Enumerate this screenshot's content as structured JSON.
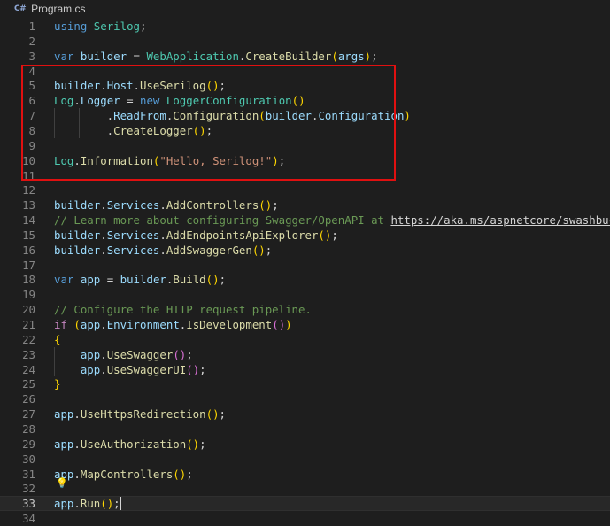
{
  "tab": {
    "icon": "csharp-icon",
    "icon_text": "C#",
    "label": "Program.cs"
  },
  "editor": {
    "current_line": 33,
    "lines": [
      {
        "n": "1",
        "tokens": [
          [
            "kw",
            "using"
          ],
          [
            "pun",
            " "
          ],
          [
            "type",
            "Serilog"
          ],
          [
            "pun",
            ";"
          ]
        ]
      },
      {
        "n": "2",
        "tokens": []
      },
      {
        "n": "3",
        "tokens": [
          [
            "kw",
            "var"
          ],
          [
            "pun",
            " "
          ],
          [
            "var",
            "builder"
          ],
          [
            "pun",
            " = "
          ],
          [
            "type",
            "WebApplication"
          ],
          [
            "pun",
            "."
          ],
          [
            "fn",
            "CreateBuilder"
          ],
          [
            "br1",
            "("
          ],
          [
            "var",
            "args"
          ],
          [
            "br1",
            ")"
          ],
          [
            "pun",
            ";"
          ]
        ]
      },
      {
        "n": "4",
        "tokens": []
      },
      {
        "n": "5",
        "tokens": [
          [
            "var",
            "builder"
          ],
          [
            "pun",
            "."
          ],
          [
            "var",
            "Host"
          ],
          [
            "pun",
            "."
          ],
          [
            "fn",
            "UseSerilog"
          ],
          [
            "br1",
            "()"
          ],
          [
            "pun",
            ";"
          ]
        ]
      },
      {
        "n": "6",
        "tokens": [
          [
            "type",
            "Log"
          ],
          [
            "pun",
            "."
          ],
          [
            "var",
            "Logger"
          ],
          [
            "pun",
            " = "
          ],
          [
            "kw",
            "new"
          ],
          [
            "pun",
            " "
          ],
          [
            "type",
            "LoggerConfiguration"
          ],
          [
            "br1",
            "()"
          ]
        ]
      },
      {
        "n": "7",
        "tokens": [
          [
            "pun",
            "        ."
          ],
          [
            "var",
            "ReadFrom"
          ],
          [
            "pun",
            "."
          ],
          [
            "fn",
            "Configuration"
          ],
          [
            "br1",
            "("
          ],
          [
            "var",
            "builder"
          ],
          [
            "pun",
            "."
          ],
          [
            "var",
            "Configuration"
          ],
          [
            "br1",
            ")"
          ]
        ]
      },
      {
        "n": "8",
        "tokens": [
          [
            "pun",
            "        ."
          ],
          [
            "fn",
            "CreateLogger"
          ],
          [
            "br1",
            "()"
          ],
          [
            "pun",
            ";"
          ]
        ]
      },
      {
        "n": "9",
        "tokens": []
      },
      {
        "n": "10",
        "tokens": [
          [
            "type",
            "Log"
          ],
          [
            "pun",
            "."
          ],
          [
            "fn",
            "Information"
          ],
          [
            "br1",
            "("
          ],
          [
            "str",
            "\"Hello, Serilog!\""
          ],
          [
            "br1",
            ")"
          ],
          [
            "pun",
            ";"
          ]
        ]
      },
      {
        "n": "11",
        "tokens": []
      },
      {
        "n": "12",
        "tokens": []
      },
      {
        "n": "13",
        "tokens": [
          [
            "var",
            "builder"
          ],
          [
            "pun",
            "."
          ],
          [
            "var",
            "Services"
          ],
          [
            "pun",
            "."
          ],
          [
            "fn",
            "AddControllers"
          ],
          [
            "br1",
            "()"
          ],
          [
            "pun",
            ";"
          ]
        ]
      },
      {
        "n": "14",
        "tokens": [
          [
            "cmt",
            "// Learn more about configuring Swagger/OpenAPI at "
          ],
          [
            "link",
            "https://aka.ms/aspnetcore/swashbuckle"
          ]
        ]
      },
      {
        "n": "15",
        "tokens": [
          [
            "var",
            "builder"
          ],
          [
            "pun",
            "."
          ],
          [
            "var",
            "Services"
          ],
          [
            "pun",
            "."
          ],
          [
            "fn",
            "AddEndpointsApiExplorer"
          ],
          [
            "br1",
            "()"
          ],
          [
            "pun",
            ";"
          ]
        ]
      },
      {
        "n": "16",
        "tokens": [
          [
            "var",
            "builder"
          ],
          [
            "pun",
            "."
          ],
          [
            "var",
            "Services"
          ],
          [
            "pun",
            "."
          ],
          [
            "fn",
            "AddSwaggerGen"
          ],
          [
            "br1",
            "()"
          ],
          [
            "pun",
            ";"
          ]
        ]
      },
      {
        "n": "17",
        "tokens": []
      },
      {
        "n": "18",
        "tokens": [
          [
            "kw",
            "var"
          ],
          [
            "pun",
            " "
          ],
          [
            "var",
            "app"
          ],
          [
            "pun",
            " = "
          ],
          [
            "var",
            "builder"
          ],
          [
            "pun",
            "."
          ],
          [
            "fn",
            "Build"
          ],
          [
            "br1",
            "()"
          ],
          [
            "pun",
            ";"
          ]
        ]
      },
      {
        "n": "19",
        "tokens": []
      },
      {
        "n": "20",
        "tokens": [
          [
            "cmt",
            "// Configure the HTTP request pipeline."
          ]
        ]
      },
      {
        "n": "21",
        "tokens": [
          [
            "ctrl",
            "if"
          ],
          [
            "pun",
            " "
          ],
          [
            "br1",
            "("
          ],
          [
            "var",
            "app"
          ],
          [
            "pun",
            "."
          ],
          [
            "var",
            "Environment"
          ],
          [
            "pun",
            "."
          ],
          [
            "fn",
            "IsDevelopment"
          ],
          [
            "br2",
            "()"
          ],
          [
            "br1",
            ")"
          ]
        ]
      },
      {
        "n": "22",
        "tokens": [
          [
            "br1",
            "{"
          ]
        ]
      },
      {
        "n": "23",
        "tokens": [
          [
            "pun",
            "    "
          ],
          [
            "var",
            "app"
          ],
          [
            "pun",
            "."
          ],
          [
            "fn",
            "UseSwagger"
          ],
          [
            "br2",
            "()"
          ],
          [
            "pun",
            ";"
          ]
        ]
      },
      {
        "n": "24",
        "tokens": [
          [
            "pun",
            "    "
          ],
          [
            "var",
            "app"
          ],
          [
            "pun",
            "."
          ],
          [
            "fn",
            "UseSwaggerUI"
          ],
          [
            "br2",
            "()"
          ],
          [
            "pun",
            ";"
          ]
        ]
      },
      {
        "n": "25",
        "tokens": [
          [
            "br1",
            "}"
          ]
        ]
      },
      {
        "n": "26",
        "tokens": []
      },
      {
        "n": "27",
        "tokens": [
          [
            "var",
            "app"
          ],
          [
            "pun",
            "."
          ],
          [
            "fn",
            "UseHttpsRedirection"
          ],
          [
            "br1",
            "()"
          ],
          [
            "pun",
            ";"
          ]
        ]
      },
      {
        "n": "28",
        "tokens": []
      },
      {
        "n": "29",
        "tokens": [
          [
            "var",
            "app"
          ],
          [
            "pun",
            "."
          ],
          [
            "fn",
            "UseAuthorization"
          ],
          [
            "br1",
            "()"
          ],
          [
            "pun",
            ";"
          ]
        ]
      },
      {
        "n": "30",
        "tokens": []
      },
      {
        "n": "31",
        "tokens": [
          [
            "var",
            "app"
          ],
          [
            "pun",
            "."
          ],
          [
            "fn",
            "MapControllers"
          ],
          [
            "br1",
            "()"
          ],
          [
            "pun",
            ";"
          ]
        ]
      },
      {
        "n": "32",
        "tokens": []
      },
      {
        "n": "33",
        "tokens": [
          [
            "var",
            "app"
          ],
          [
            "pun",
            "."
          ],
          [
            "fn",
            "Run"
          ],
          [
            "br1",
            "()"
          ],
          [
            "pun",
            ";"
          ]
        ]
      },
      {
        "n": "34",
        "tokens": []
      }
    ],
    "lightbulb_icon": "lightbulb-icon",
    "highlight_color": "#e01010"
  }
}
